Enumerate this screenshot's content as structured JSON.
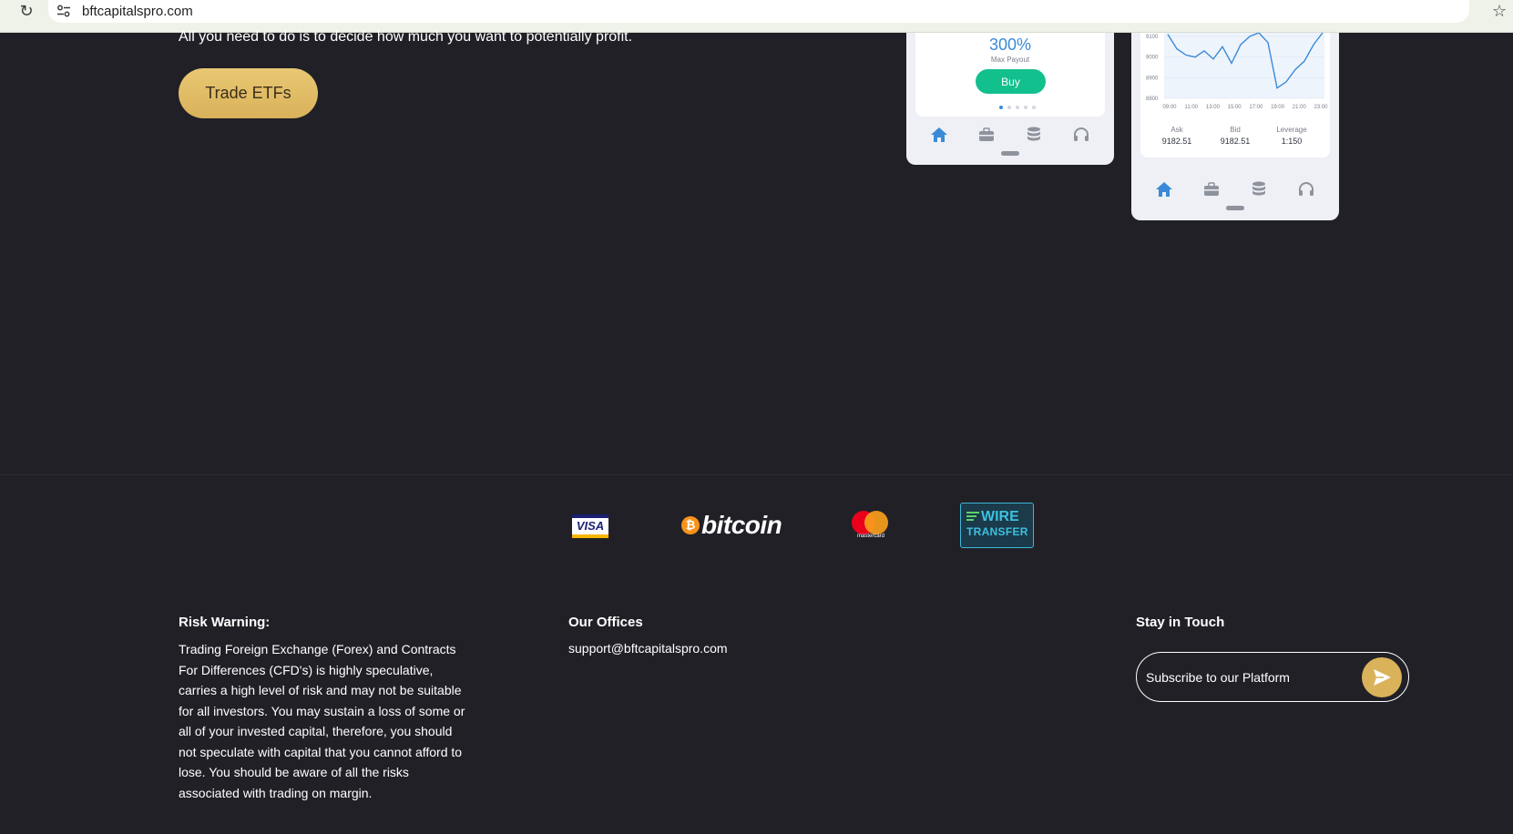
{
  "browser": {
    "url": "bftcapitalspro.com",
    "icons": [
      "reload-icon",
      "site-settings-icon",
      "bookmark-star-icon"
    ]
  },
  "hero": {
    "text": "All you need to do is to decide how much you want to potentially profit.",
    "cta_label": "Trade ETFs",
    "accent_color": "#d9b25a"
  },
  "phone_left": {
    "payout_value": "300%",
    "payout_label": "Max Payout",
    "buy_label": "Buy",
    "carousel_dots": 5,
    "active_dot": 1,
    "nav_icons": [
      "home-icon",
      "briefcase-icon",
      "database-icon",
      "headset-icon"
    ]
  },
  "phone_right": {
    "chart_data": {
      "type": "line",
      "x": [
        "09:00",
        "11:00",
        "13:00",
        "15:00",
        "17:00",
        "19:00",
        "21:00",
        "23:00"
      ],
      "y_ticks": [
        "9100",
        "9000",
        "8900",
        "8800"
      ],
      "ylim": [
        8800,
        9100
      ],
      "series": [
        {
          "values": [
            9110,
            9040,
            9010,
            9000,
            9030,
            8990,
            9050,
            8970,
            9060,
            9100,
            9150,
            9070,
            8850,
            8880,
            8940,
            8980,
            9060,
            9120
          ]
        }
      ]
    },
    "quotes": [
      {
        "label": "Ask",
        "value": "9182.51"
      },
      {
        "label": "Bid",
        "value": "9182.51"
      },
      {
        "label": "Leverage",
        "value": "1:150"
      }
    ],
    "nav_icons": [
      "home-icon",
      "briefcase-icon",
      "database-icon",
      "headset-icon"
    ]
  },
  "payments": {
    "visa": "VISA",
    "bitcoin": "bitcoin",
    "bitcoin_symbol": "₿",
    "mastercard": "mastercard",
    "wire_top": "WIRE",
    "wire_bottom": "TRANSFER"
  },
  "footer": {
    "risk_heading": "Risk Warning:",
    "risk_text": "Trading Foreign Exchange (Forex) and Contracts For Differences (CFD's) is highly speculative, carries a high level of risk and may not be suitable for all investors. You may sustain a loss of some or all of your invested capital, therefore, you should not speculate with capital that you cannot afford to lose. You should be aware of all the risks associated with trading on margin.",
    "offices_heading": "Our Offices",
    "email": "support@bftcapitalspro.com",
    "touch_heading": "Stay in Touch",
    "subscribe_placeholder": "Subscribe to our Platform"
  }
}
